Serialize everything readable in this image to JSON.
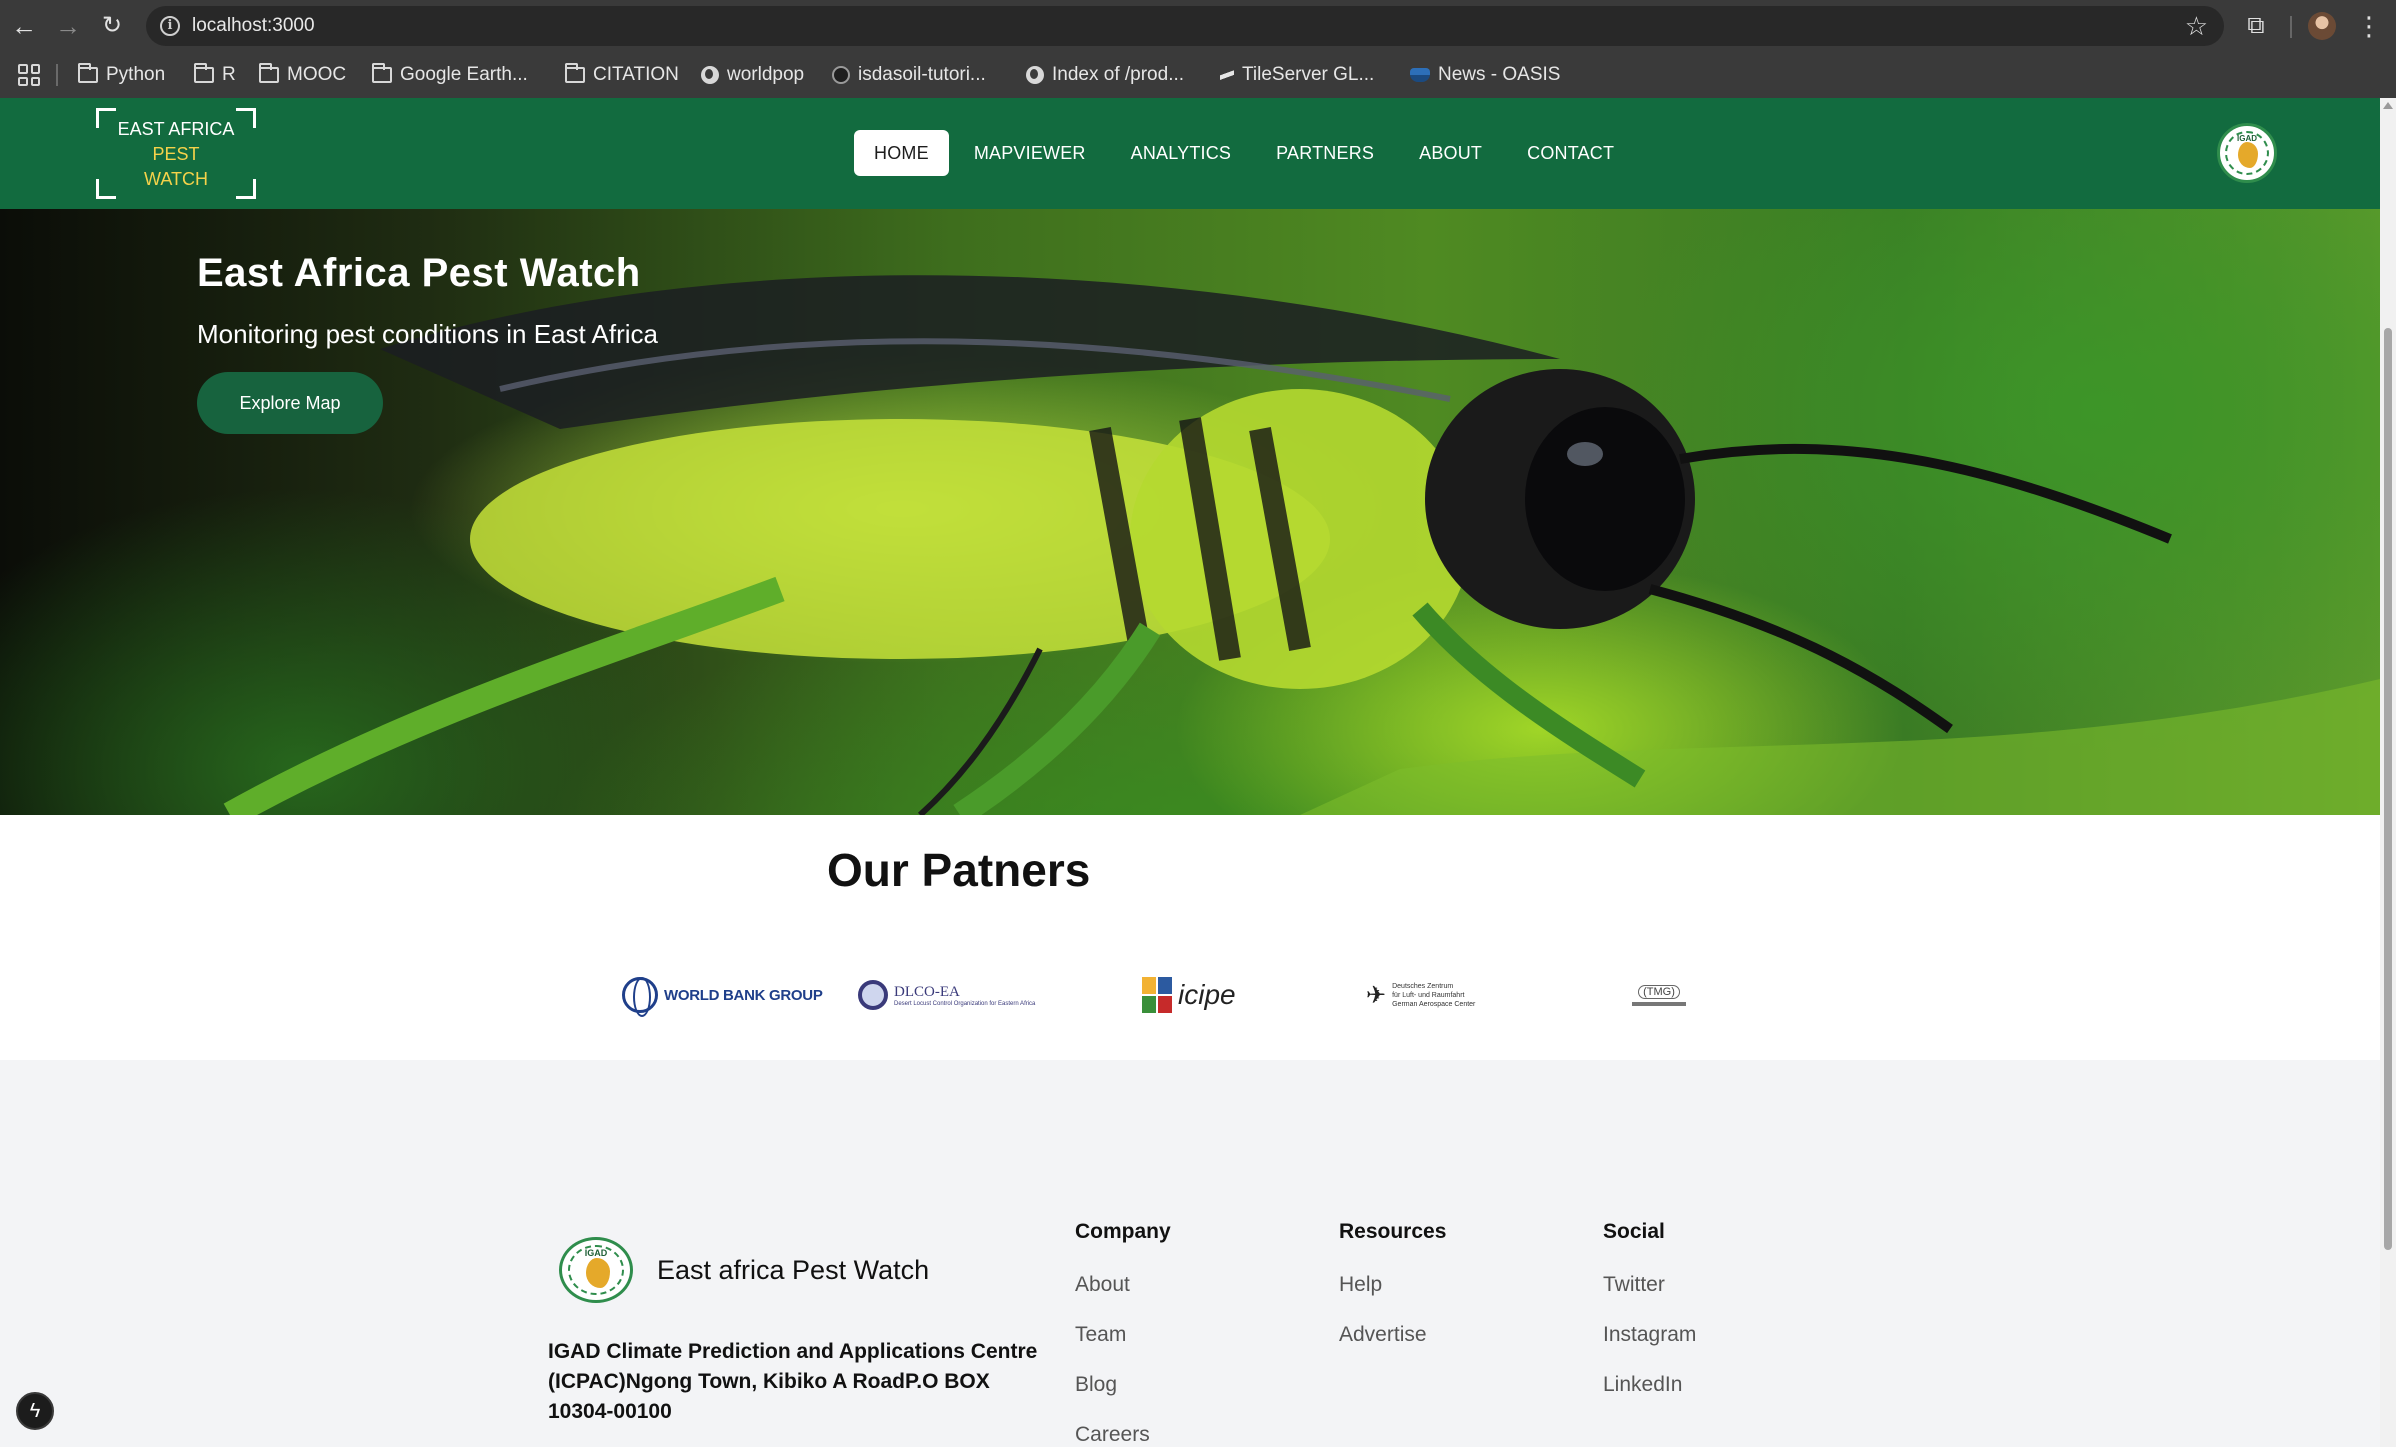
{
  "browser": {
    "url": "localhost:3000",
    "bookmarks": [
      {
        "label": "Python",
        "icon": "folder-icon"
      },
      {
        "label": "R",
        "icon": "folder-icon"
      },
      {
        "label": "MOOC",
        "icon": "folder-icon"
      },
      {
        "label": "Google Earth...",
        "icon": "folder-icon"
      },
      {
        "label": "CITATION",
        "icon": "folder-icon"
      },
      {
        "label": "worldpop",
        "icon": "globe-icon"
      },
      {
        "label": "isdasoil-tutori...",
        "icon": "github-icon"
      },
      {
        "label": "Index of /prod...",
        "icon": "globe-icon"
      },
      {
        "label": "TileServer GL...",
        "icon": "tileserver-icon"
      },
      {
        "label": "News - OASIS",
        "icon": "oasis-icon"
      }
    ]
  },
  "header": {
    "logo": {
      "line1": "EAST AFRICA",
      "line2": "PEST",
      "line3": "WATCH"
    },
    "nav": [
      {
        "label": "HOME",
        "active": true
      },
      {
        "label": "MAPVIEWER",
        "active": false
      },
      {
        "label": "ANALYTICS",
        "active": false
      },
      {
        "label": "PARTNERS",
        "active": false
      },
      {
        "label": "ABOUT",
        "active": false
      },
      {
        "label": "CONTACT",
        "active": false
      }
    ],
    "emblem_label": "IGAD"
  },
  "hero": {
    "title": "East Africa Pest Watch",
    "subtitle": "Monitoring pest conditions in East Africa",
    "cta": "Explore Map"
  },
  "partners": {
    "title": "Our Patners",
    "logos": {
      "worldbank": "WORLD BANK GROUP",
      "dlco_name": "DLCO-EA",
      "dlco_sub": "Desert Locust Control Organization for Eastern Africa",
      "icipe": "icipe",
      "dlr_line1": "Deutsches Zentrum",
      "dlr_line2": "für Luft- und Raumfahrt",
      "dlr_line3": "German Aerospace Center",
      "tmg": "(TMG)"
    }
  },
  "footer": {
    "logo_label": "IGAD",
    "brand": "East africa Pest Watch",
    "address": "IGAD Climate Prediction and Applications Centre (ICPAC)Ngong Town, Kibiko A RoadP.O BOX 10304-00100",
    "columns": [
      {
        "title": "Company",
        "links": [
          "About",
          "Team",
          "Blog",
          "Careers"
        ]
      },
      {
        "title": "Resources",
        "links": [
          "Help",
          "Advertise"
        ]
      },
      {
        "title": "Social",
        "links": [
          "Twitter",
          "Instagram",
          "LinkedIn"
        ]
      }
    ]
  },
  "colors": {
    "header_bg": "#126b3f",
    "logo_accent": "#f4d24a",
    "cta_bg": "#17633e",
    "footer_bg": "#f3f4f6"
  }
}
